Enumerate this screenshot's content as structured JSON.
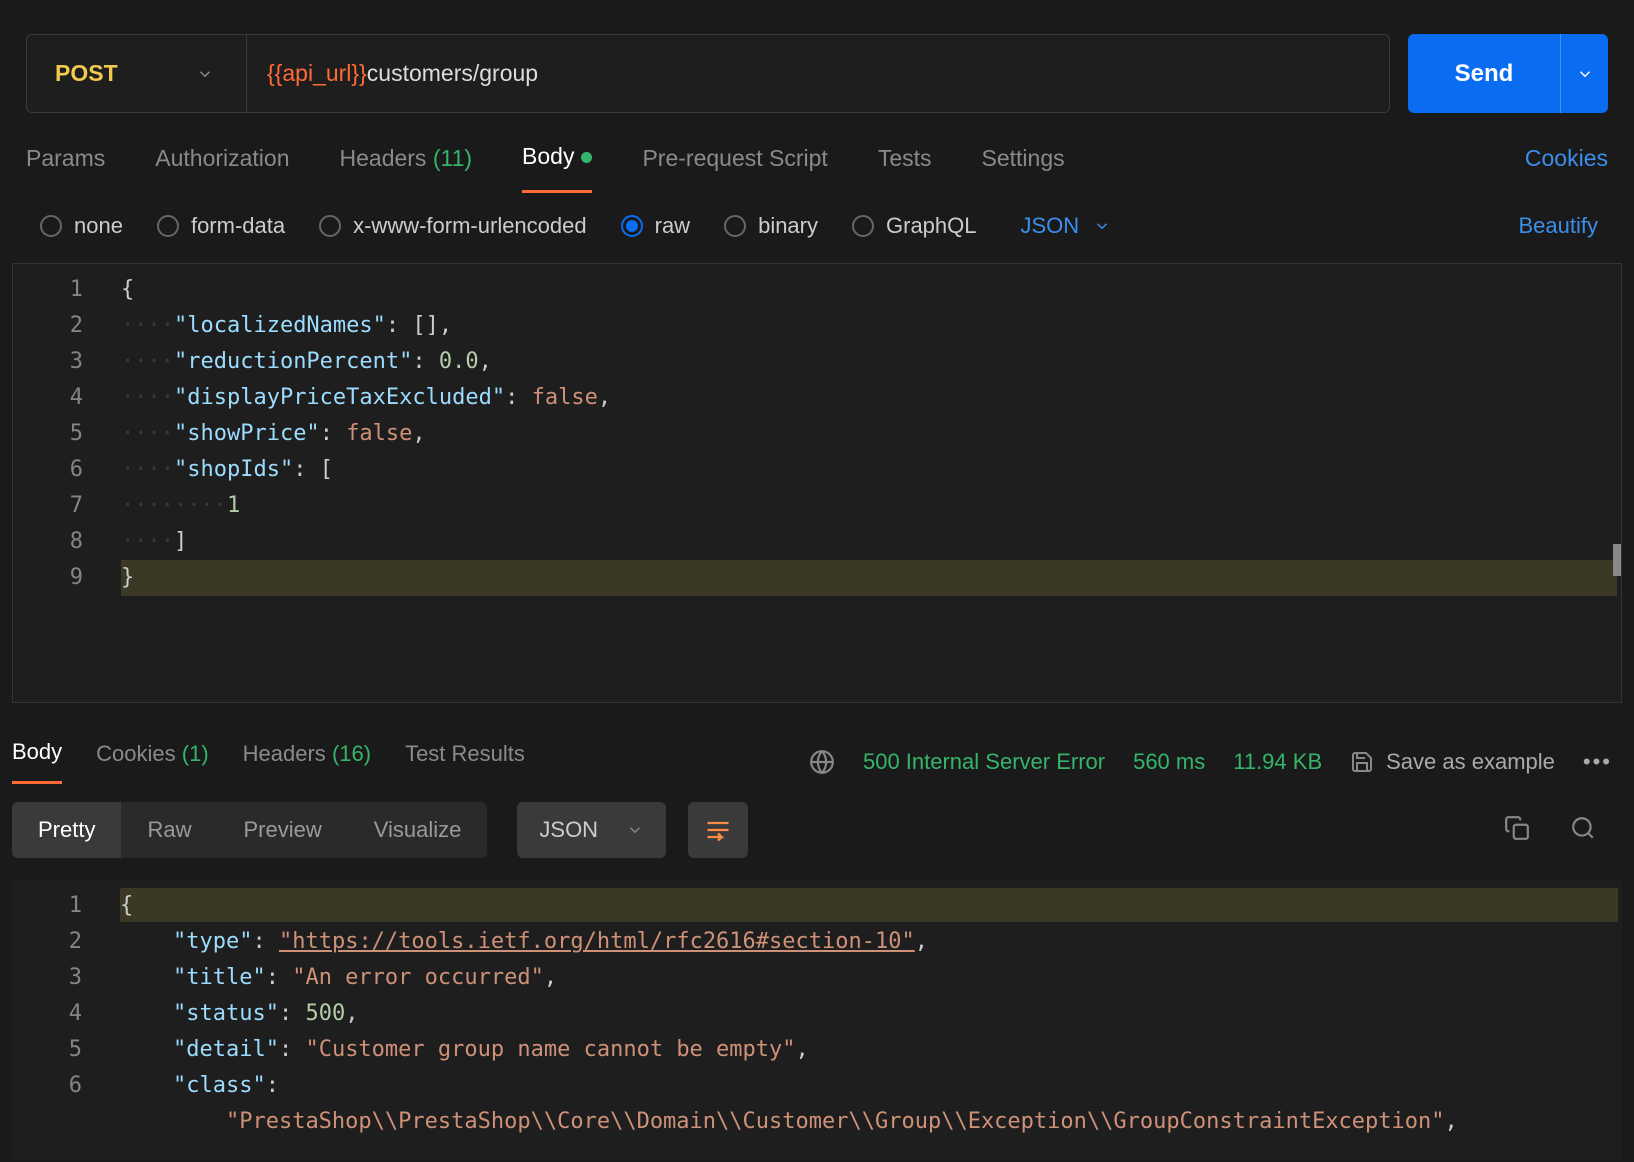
{
  "request": {
    "method": "POST",
    "url_variable": "{{api_url}}",
    "url_path": "customers/group",
    "send_label": "Send"
  },
  "tabs": {
    "params": "Params",
    "auth": "Authorization",
    "headers": "Headers",
    "headers_count": "(11)",
    "body": "Body",
    "prereq": "Pre-request Script",
    "tests": "Tests",
    "settings": "Settings",
    "cookies": "Cookies"
  },
  "body_opts": {
    "none": "none",
    "form": "form-data",
    "urlenc": "x-www-form-urlencoded",
    "raw": "raw",
    "binary": "binary",
    "graphql": "GraphQL",
    "json": "JSON",
    "beautify": "Beautify"
  },
  "req_body_lines": [
    "1",
    "2",
    "3",
    "4",
    "5",
    "6",
    "7",
    "8",
    "9"
  ],
  "req_body": {
    "l1": "{",
    "l2_key": "\"localizedNames\"",
    "l2_rest": ": [],",
    "l3_key": "\"reductionPercent\"",
    "l3_rest": ": ",
    "l3_num": "0.0",
    "l3_c": ",",
    "l4_key": "\"displayPriceTaxExcluded\"",
    "l4_rest": ": ",
    "l4_b": "false",
    "l4_c": ",",
    "l5_key": "\"showPrice\"",
    "l5_rest": ": ",
    "l5_b": "false",
    "l5_c": ",",
    "l6_key": "\"shopIds\"",
    "l6_rest": ": [",
    "l7_num": "1",
    "l8": "]",
    "l9": "}"
  },
  "resp_tabs": {
    "body": "Body",
    "cookies": "Cookies",
    "cookies_count": "(1)",
    "headers": "Headers",
    "headers_count": "(16)",
    "tests": "Test Results"
  },
  "status": {
    "code": "500 Internal Server Error",
    "time": "560 ms",
    "size": "11.94 KB",
    "save": "Save as example"
  },
  "view": {
    "pretty": "Pretty",
    "raw": "Raw",
    "preview": "Preview",
    "visualize": "Visualize",
    "json": "JSON"
  },
  "resp_lines": [
    "1",
    "2",
    "3",
    "4",
    "5",
    "6"
  ],
  "resp": {
    "l1": "{",
    "l2k": "\"type\"",
    "l2v": "\"https://tools.ietf.org/html/rfc2616#section-10\"",
    "l3k": "\"title\"",
    "l3v": "\"An error occurred\"",
    "l4k": "\"status\"",
    "l4v": "500",
    "l5k": "\"detail\"",
    "l5v": "\"Customer group name cannot be empty\"",
    "l6k": "\"class\"",
    "l6cont": "\"PrestaShop\\\\PrestaShop\\\\Core\\\\Domain\\\\Customer\\\\Group\\\\Exception\\\\GroupConstraintException\""
  }
}
